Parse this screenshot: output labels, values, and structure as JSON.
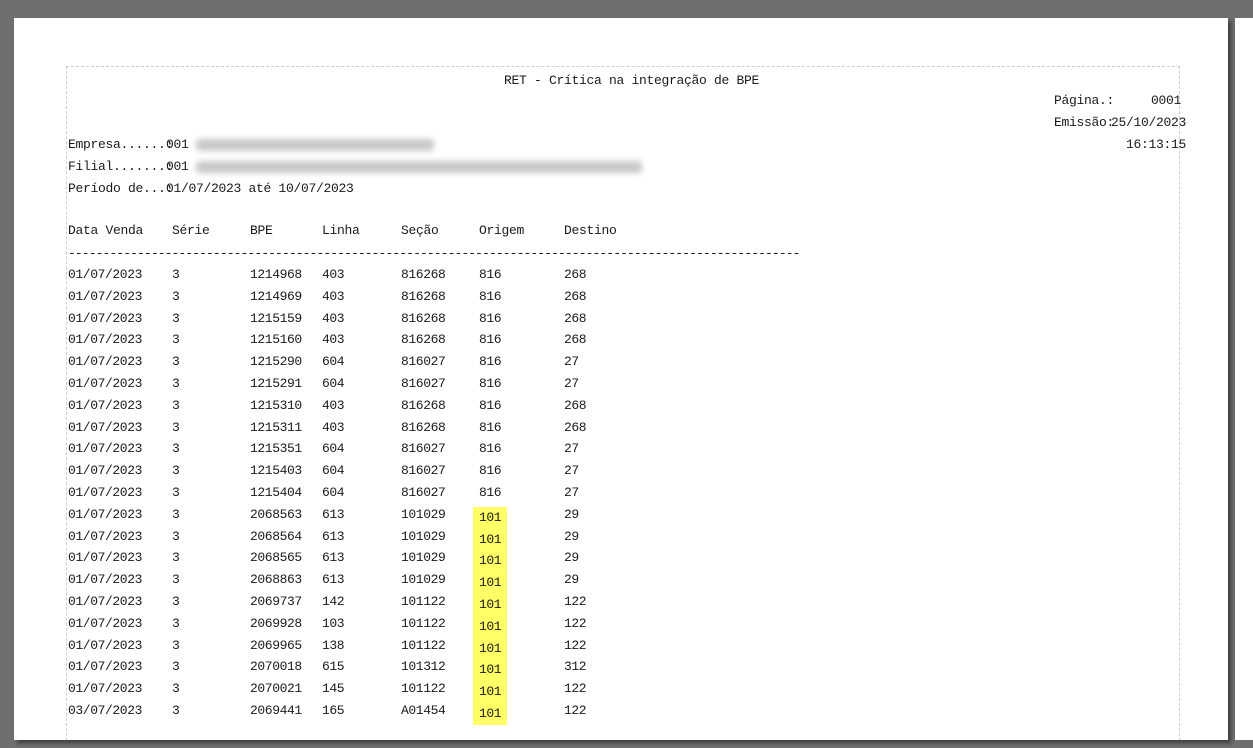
{
  "report": {
    "title": "RET - Crítica na integração de BPE",
    "pagina_label": "Página.:",
    "pagina_value": "0001",
    "emissao_label": "Emissão:",
    "emissao_value": "25/10/2023",
    "hora": "16:13:15",
    "empresa_label": "Empresa......:",
    "empresa_code": "001",
    "filial_label": "Filial.......:",
    "filial_code": "001",
    "periodo_label": "Período de...:",
    "periodo_value": "01/07/2023 até 10/07/2023",
    "separator": "--------------------------------------------------------------------------------------------------------------------"
  },
  "columns": [
    "Data Venda",
    "Série",
    "BPE",
    "Linha",
    "Seção",
    "Origem",
    "Destino"
  ],
  "highlight_color": "#ffff66",
  "rows": [
    {
      "data": "01/07/2023",
      "serie": "3",
      "bpe": "1214968",
      "linha": "403",
      "secao": "816268",
      "origem": "816",
      "destino": "268",
      "hl": false
    },
    {
      "data": "01/07/2023",
      "serie": "3",
      "bpe": "1214969",
      "linha": "403",
      "secao": "816268",
      "origem": "816",
      "destino": "268",
      "hl": false
    },
    {
      "data": "01/07/2023",
      "serie": "3",
      "bpe": "1215159",
      "linha": "403",
      "secao": "816268",
      "origem": "816",
      "destino": "268",
      "hl": false
    },
    {
      "data": "01/07/2023",
      "serie": "3",
      "bpe": "1215160",
      "linha": "403",
      "secao": "816268",
      "origem": "816",
      "destino": "268",
      "hl": false
    },
    {
      "data": "01/07/2023",
      "serie": "3",
      "bpe": "1215290",
      "linha": "604",
      "secao": "816027",
      "origem": "816",
      "destino": "27",
      "hl": false
    },
    {
      "data": "01/07/2023",
      "serie": "3",
      "bpe": "1215291",
      "linha": "604",
      "secao": "816027",
      "origem": "816",
      "destino": "27",
      "hl": false
    },
    {
      "data": "01/07/2023",
      "serie": "3",
      "bpe": "1215310",
      "linha": "403",
      "secao": "816268",
      "origem": "816",
      "destino": "268",
      "hl": false
    },
    {
      "data": "01/07/2023",
      "serie": "3",
      "bpe": "1215311",
      "linha": "403",
      "secao": "816268",
      "origem": "816",
      "destino": "268",
      "hl": false
    },
    {
      "data": "01/07/2023",
      "serie": "3",
      "bpe": "1215351",
      "linha": "604",
      "secao": "816027",
      "origem": "816",
      "destino": "27",
      "hl": false
    },
    {
      "data": "01/07/2023",
      "serie": "3",
      "bpe": "1215403",
      "linha": "604",
      "secao": "816027",
      "origem": "816",
      "destino": "27",
      "hl": false
    },
    {
      "data": "01/07/2023",
      "serie": "3",
      "bpe": "1215404",
      "linha": "604",
      "secao": "816027",
      "origem": "816",
      "destino": "27",
      "hl": false
    },
    {
      "data": "01/07/2023",
      "serie": "3",
      "bpe": "2068563",
      "linha": "613",
      "secao": "101029",
      "origem": "101",
      "destino": "29",
      "hl": true
    },
    {
      "data": "01/07/2023",
      "serie": "3",
      "bpe": "2068564",
      "linha": "613",
      "secao": "101029",
      "origem": "101",
      "destino": "29",
      "hl": true
    },
    {
      "data": "01/07/2023",
      "serie": "3",
      "bpe": "2068565",
      "linha": "613",
      "secao": "101029",
      "origem": "101",
      "destino": "29",
      "hl": true
    },
    {
      "data": "01/07/2023",
      "serie": "3",
      "bpe": "2068863",
      "linha": "613",
      "secao": "101029",
      "origem": "101",
      "destino": "29",
      "hl": true
    },
    {
      "data": "01/07/2023",
      "serie": "3",
      "bpe": "2069737",
      "linha": "142",
      "secao": "101122",
      "origem": "101",
      "destino": "122",
      "hl": true
    },
    {
      "data": "01/07/2023",
      "serie": "3",
      "bpe": "2069928",
      "linha": "103",
      "secao": "101122",
      "origem": "101",
      "destino": "122",
      "hl": true
    },
    {
      "data": "01/07/2023",
      "serie": "3",
      "bpe": "2069965",
      "linha": "138",
      "secao": "101122",
      "origem": "101",
      "destino": "122",
      "hl": true
    },
    {
      "data": "01/07/2023",
      "serie": "3",
      "bpe": "2070018",
      "linha": "615",
      "secao": "101312",
      "origem": "101",
      "destino": "312",
      "hl": true
    },
    {
      "data": "01/07/2023",
      "serie": "3",
      "bpe": "2070021",
      "linha": "145",
      "secao": "101122",
      "origem": "101",
      "destino": "122",
      "hl": true
    },
    {
      "data": "03/07/2023",
      "serie": "3",
      "bpe": "2069441",
      "linha": "165",
      "secao": "A01454",
      "origem": "101",
      "destino": "122",
      "hl": true
    }
  ]
}
